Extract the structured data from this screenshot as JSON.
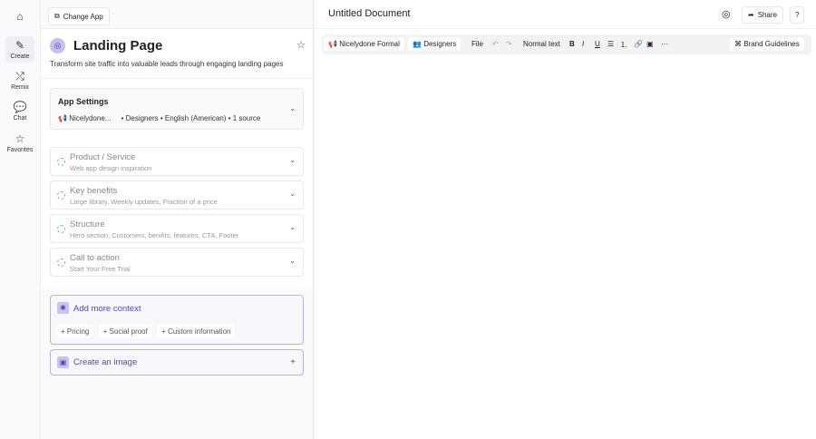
{
  "nav": {
    "items": [
      {
        "label": "Create"
      },
      {
        "label": "Remix"
      },
      {
        "label": "Chat"
      },
      {
        "label": "Favorites"
      }
    ]
  },
  "left": {
    "change_app": "Change App",
    "title": "Landing Page",
    "description": "Transform site traffic into valuable leads through engaging landing pages",
    "settings": {
      "title": "App Settings",
      "voice": "Nicelydone...",
      "meta": "• Designers • English (American) • 1 source"
    },
    "fields": [
      {
        "label": "Product / Service",
        "value": "Web app design inspiration"
      },
      {
        "label": "Key benefits",
        "value": "Large library, Weekly updates, Fraction of a price"
      },
      {
        "label": "Structure",
        "value": "Hero section, Customers, benifits, features, CTA, Footer"
      },
      {
        "label": "Call to action",
        "value": "Start Your Free Trial"
      }
    ],
    "context": {
      "title": "Add more context",
      "chips": [
        "Pricing",
        "Social proof",
        "Custom information"
      ]
    },
    "image": {
      "title": "Create an image"
    }
  },
  "doc": {
    "title": "Untitled Document",
    "share": "Share",
    "toolbar": {
      "voice": "Nicelydone Formal",
      "audience": "Designers",
      "file": "File",
      "style": "Normal text",
      "brand": "Brand Guidelines"
    }
  },
  "colors": {
    "accent": "#5546b8"
  }
}
